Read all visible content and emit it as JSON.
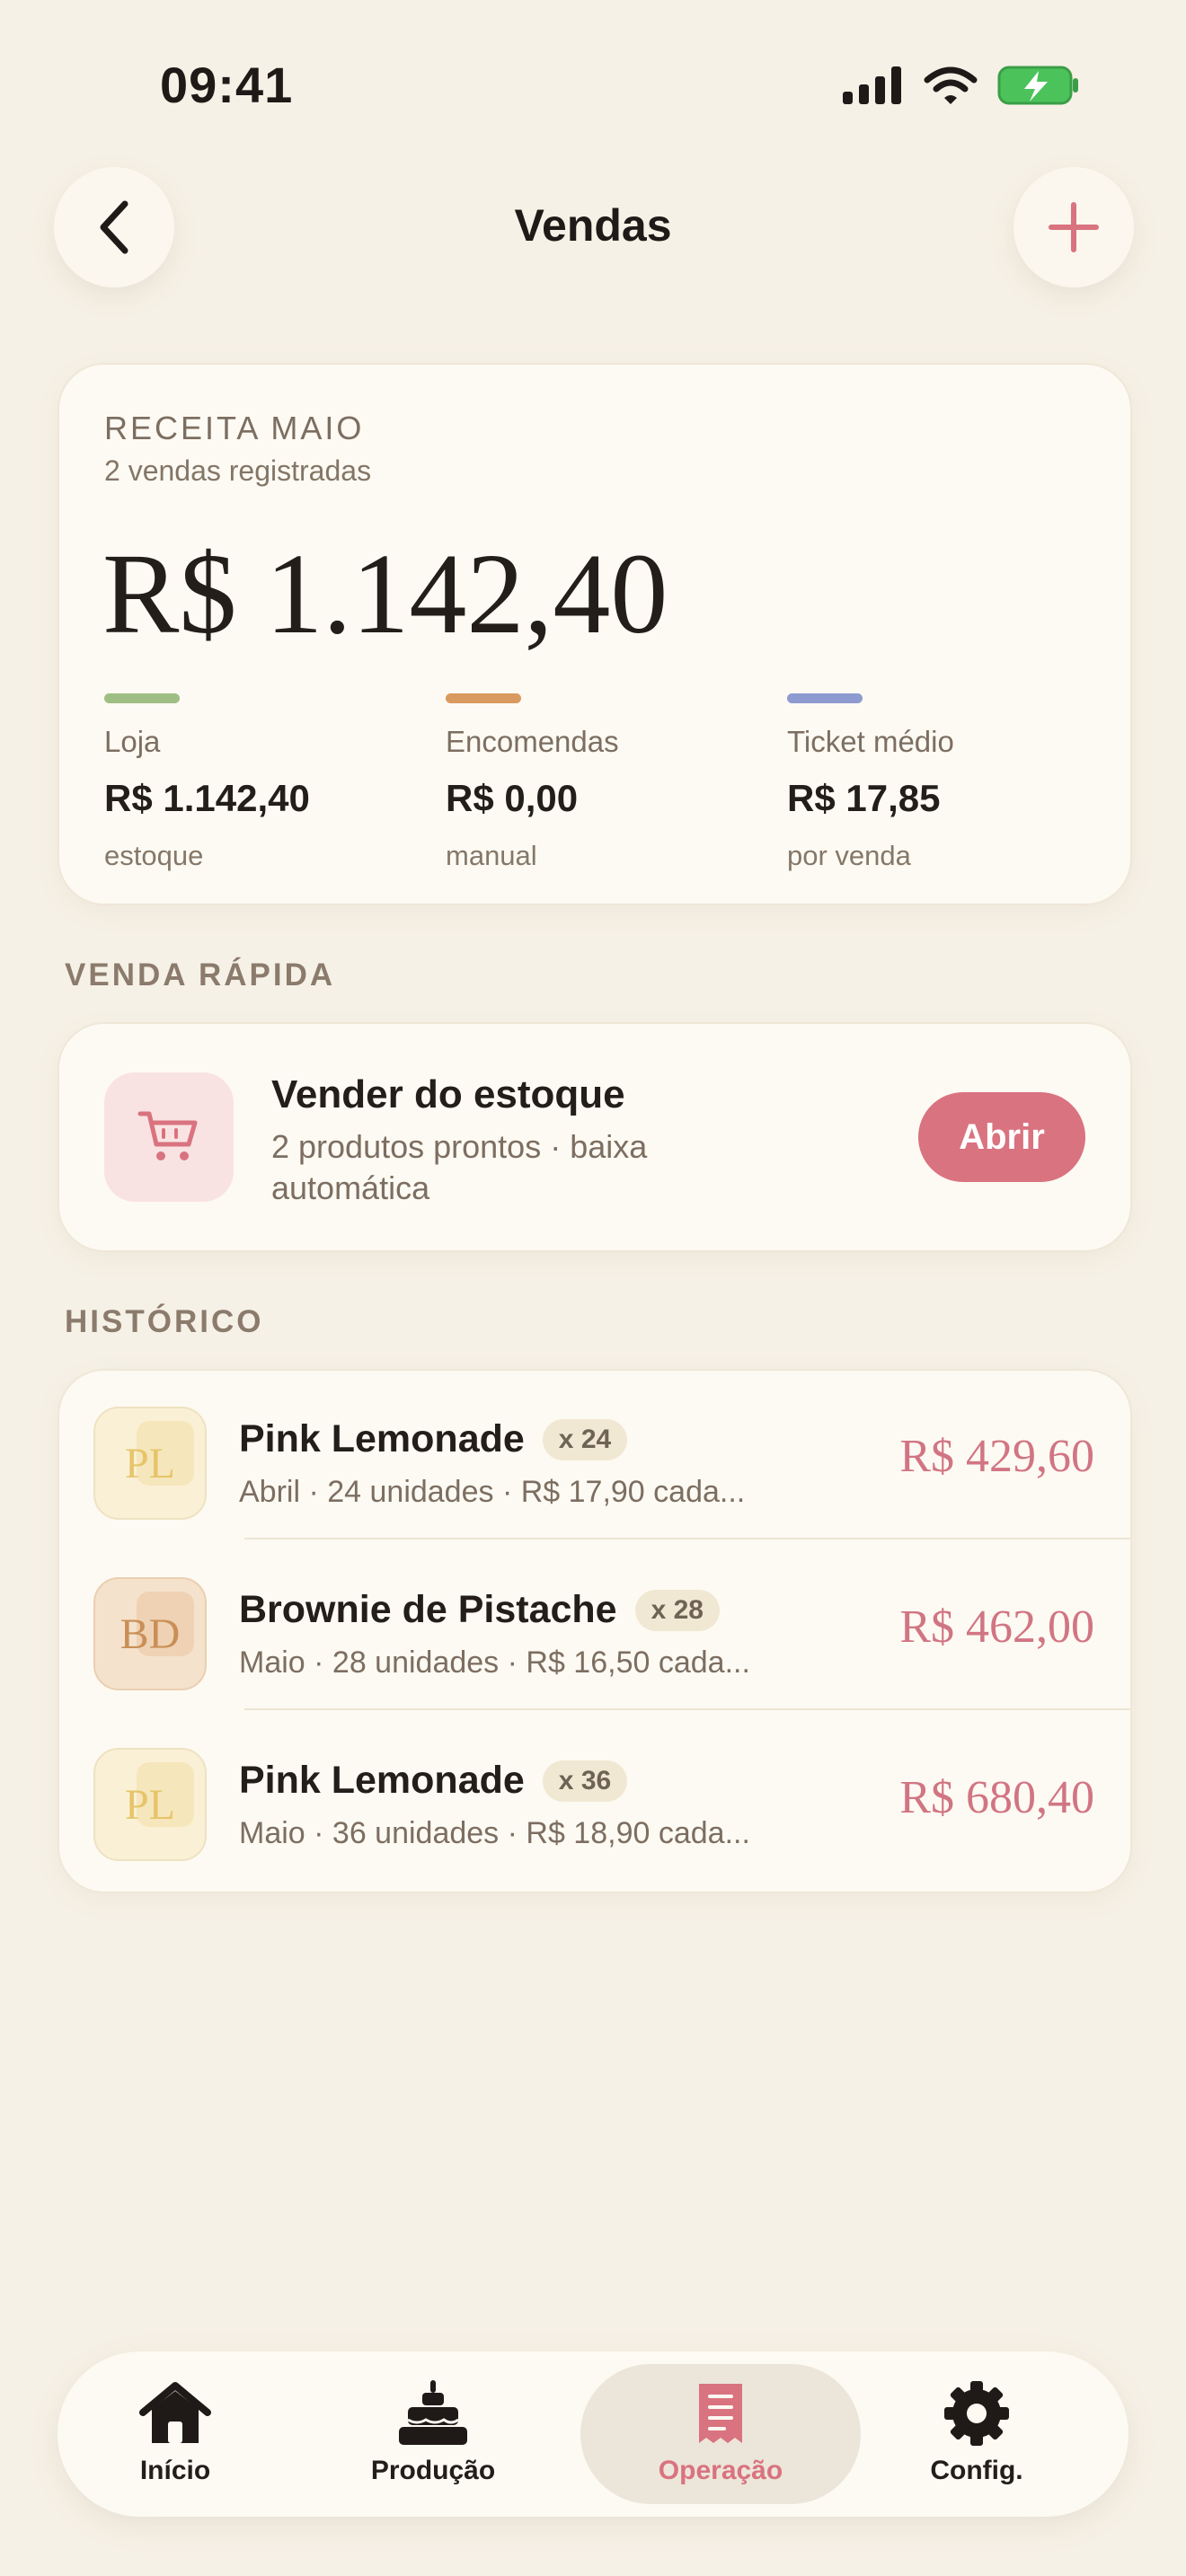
{
  "status_bar": {
    "time": "09:41"
  },
  "header": {
    "title": "Vendas"
  },
  "summary": {
    "label": "RECEITA MAIO",
    "sub": "2 vendas registradas",
    "total": "R$ 1.142,40",
    "metrics": [
      {
        "label": "Loja",
        "value": "R$ 1.142,40",
        "note": "estoque",
        "color": "#9fbe84"
      },
      {
        "label": "Encomendas",
        "value": "R$ 0,00",
        "note": "manual",
        "color": "#d99a5f"
      },
      {
        "label": "Ticket médio",
        "value": "R$ 17,85",
        "note": "por venda",
        "color": "#8d9bd1"
      }
    ]
  },
  "quick_sale": {
    "section_label": "VENDA RÁPIDA",
    "title": "Vender do estoque",
    "sub": "2 produtos prontos · baixa automática",
    "button": "Abrir",
    "icon": "cart-icon"
  },
  "history": {
    "section_label": "HISTÓRICO",
    "items": [
      {
        "initials": "PL",
        "name": "Pink Lemonade",
        "qty": "x 24",
        "sub": "Abril · 24 unidades · R$ 17,90 cada...",
        "price": "R$ 429,60",
        "avatar_bg": "#faf0d6",
        "avatar_fg": "#e6c56a"
      },
      {
        "initials": "BD",
        "name": "Brownie de Pistache",
        "qty": "x 28",
        "sub": "Maio · 28 unidades · R$ 16,50 cada...",
        "price": "R$ 462,00",
        "avatar_bg": "#f5e2cc",
        "avatar_fg": "#c98f57"
      },
      {
        "initials": "PL",
        "name": "Pink Lemonade",
        "qty": "x 36",
        "sub": "Maio · 36 unidades · R$ 18,90 cada...",
        "price": "R$ 680,40",
        "avatar_bg": "#faf0d6",
        "avatar_fg": "#e6c56a"
      }
    ]
  },
  "nav": {
    "items": [
      {
        "label": "Início",
        "icon": "home-icon"
      },
      {
        "label": "Produção",
        "icon": "cake-icon"
      },
      {
        "label": "Operação",
        "icon": "receipt-icon",
        "active": true
      },
      {
        "label": "Config.",
        "icon": "gear-icon"
      }
    ]
  }
}
